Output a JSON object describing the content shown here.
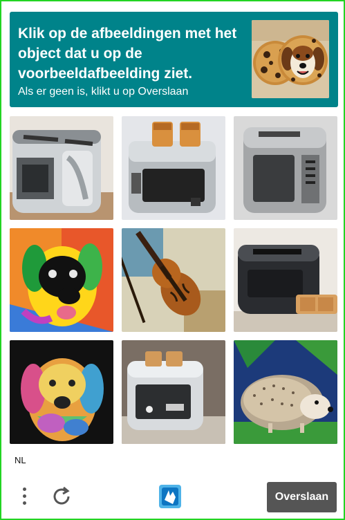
{
  "challenge": {
    "title": "Klik op de afbeeldingen met het object dat u op de voorbeeldafbeelding ziet.",
    "subtitle": "Als er geen is, klikt u op Overslaan",
    "example_image": "cookie-dog"
  },
  "tiles": [
    {
      "subject": "toaster"
    },
    {
      "subject": "toaster"
    },
    {
      "subject": "toaster"
    },
    {
      "subject": "dog"
    },
    {
      "subject": "violin"
    },
    {
      "subject": "toaster"
    },
    {
      "subject": "dog"
    },
    {
      "subject": "toaster"
    },
    {
      "subject": "hedgehog"
    }
  ],
  "footer": {
    "language": "NL",
    "skip_label": "Overslaan",
    "menu_icon": "more-vertical-icon",
    "refresh_icon": "refresh-icon",
    "logo_icon": "hcaptcha-logo-icon"
  },
  "colors": {
    "header_bg": "#00838a",
    "skip_bg": "#555555",
    "frame_border": "#22d422"
  }
}
